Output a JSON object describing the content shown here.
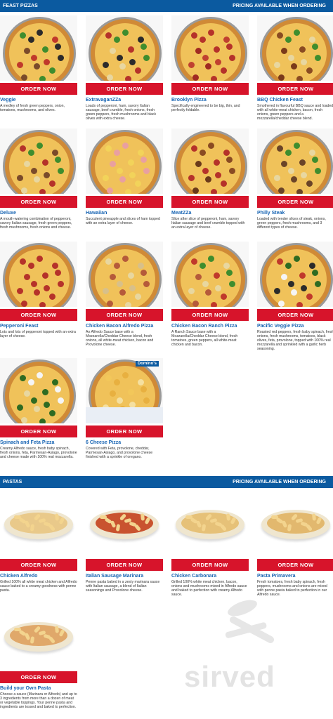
{
  "sections": {
    "feast": {
      "title": "FEAST PIZZAS",
      "note": "PRICING AVAILABLE WHEN ORDERING"
    },
    "pastas": {
      "title": "PASTAS",
      "note": "PRICING AVAILABLE WHEN ORDERING"
    }
  },
  "order_label": "ORDER NOW",
  "pizzas": [
    {
      "name": "Veggie",
      "desc": "A medley of fresh green peppers, onion, tomatoes, mushrooms, and olives.",
      "toppings": [
        "#3f8d2e",
        "#2b2b2b",
        "#c0392b",
        "#7a4a2a"
      ]
    },
    {
      "name": "ExtravaganZZa",
      "desc": "Loads of pepperoni, ham, savory Italian sausage, beef crumble, fresh onions, fresh green peppers, fresh mushrooms and black olives with extra cheese.",
      "toppings": [
        "#b5322a",
        "#3f8d2e",
        "#2b2b2b",
        "#e8d7a0"
      ]
    },
    {
      "name": "Brooklyn Pizza",
      "desc": "Specifically engineered to be big, thin, and perfectly foldable.",
      "toppings": [
        "#b5322a",
        "#b5322a",
        "#c04030",
        "#a02a22"
      ]
    },
    {
      "name": "BBQ Chicken Feast",
      "desc": "Smothered in flavourful BBQ sauce and loaded with all white-meat chicken, bacon, fresh onions, green peppers and a mozzarella/cheddar cheese blend.",
      "toppings": [
        "#8a4b22",
        "#3f8d2e",
        "#e8d7a0",
        "#7a3a1a"
      ]
    },
    {
      "name": "Deluxe",
      "desc": "A mouth-watering combination of pepperoni, savory Italian sausage, fresh green peppers, fresh mushrooms, fresh onions and cheese.",
      "toppings": [
        "#b5322a",
        "#3f8d2e",
        "#7a4a2a",
        "#e8d7a0"
      ]
    },
    {
      "name": "Hawaiian",
      "desc": "Succulent pineapple and slices of ham topped with an extra layer of cheese.",
      "toppings": [
        "#f2d35a",
        "#e9a0a0",
        "#f2d35a",
        "#e9a0a0"
      ]
    },
    {
      "name": "MeatZZa",
      "desc": "Slice after slice of pepperoni, ham, savory Italian sausage and beef crumble topped with an extra layer of cheese.",
      "toppings": [
        "#b5322a",
        "#8a4b22",
        "#b5322a",
        "#6a3a1a"
      ]
    },
    {
      "name": "Philly Steak",
      "desc": "Loaded with tender slices of steak, onions, green peppers, fresh mushrooms, and 3 different types of cheese.",
      "toppings": [
        "#6a4428",
        "#3f8d2e",
        "#e8d7a0",
        "#6a4428"
      ]
    },
    {
      "name": "Pepperoni Feast",
      "desc": "Lots and lots of pepperoni topped with an extra layer of cheese.",
      "toppings": [
        "#b5322a",
        "#b5322a",
        "#b5322a",
        "#b5322a"
      ]
    },
    {
      "name": "Chicken Bacon Alfredo Pizza",
      "desc": "An Alfredo Sauce base with a Mozzarella/Cheddar Cheese blend, fresh onions, all white-meat chicken, bacon and Provolone cheese.",
      "toppings": [
        "#e8d7a0",
        "#b55a3a",
        "#d8c08a",
        "#b55a3a"
      ]
    },
    {
      "name": "Chicken Bacon Ranch Pizza",
      "desc": "A Ranch Sauce base with a Mozzarella/Cheddar Cheese blend, fresh tomatoes, green peppers, all white-meat chicken and bacon.",
      "toppings": [
        "#c0392b",
        "#3f8d2e",
        "#e8d7a0",
        "#b55a3a"
      ]
    },
    {
      "name": "Pacific Veggie Pizza",
      "desc": "Roasted red peppers, fresh baby spinach, fresh onions, fresh mushrooms, tomatoes, black olives, feta, provolone, topped with 100% real mozzarella and sprinkled with a garlic herb seasoning.",
      "toppings": [
        "#c0392b",
        "#2f6b22",
        "#2b2b2b",
        "#f5f5f5"
      ]
    },
    {
      "name": "Spinach and Feta Pizza",
      "desc": "Creamy Alfredo sauce, fresh baby spinach, fresh onions, feta, Parmesan-Asiago, provolone and cheese made with 100% real mozzarella.",
      "toppings": [
        "#2f6b22",
        "#f5f5f5",
        "#2f6b22",
        "#e8d7a0"
      ]
    },
    {
      "name": "6 Cheese Pizza",
      "desc": "Covered with Feta, provolone, cheddar, Parmesan-Asiago, and provolone cheese finished with a sprinkle of oregano.",
      "toppings": [
        "#f2c75a",
        "#e8b040",
        "#f5e0a0",
        "#e8b040"
      ],
      "box_label": "Domino's"
    }
  ],
  "pastas": [
    {
      "name": "Chicken Alfredo",
      "desc": "Grilled 100% all white meat chicken and Alfredo sauce baked to a creamy goodness with penne pasta.",
      "sauce": "#e9c98a"
    },
    {
      "name": "Italian Sausage Marinara",
      "desc": "Penne pasta baked in a zesty marinara sauce with Italian sausage, a blend of Italian seasonings and Provolone cheese.",
      "sauce": "#c9532f"
    },
    {
      "name": "Chicken Carbonara",
      "desc": "Grilled 100% white meat chicken, bacon, onions and mushrooms mixed in Alfredo sauce and baked to perfection with creamy Alfredo sauce.",
      "sauce": "#e6c178"
    },
    {
      "name": "Pasta Primavera",
      "desc": "Fresh tomatoes, fresh baby spinach, fresh peppers, mushrooms and onions are mixed with penne pasta baked to perfection in our Alfredo sauce.",
      "sauce": "#e2b86e"
    },
    {
      "name": "Build your Own Pasta",
      "desc": "Choose a sauce (Marinara or Alfredo) and up to 3 ingredients from more than a dozen of meat or vegetable toppings. Your penne pasta and ingredients are tossed and baked to perfection.",
      "sauce": "#e0a86a"
    }
  ],
  "watermark": "sirved"
}
